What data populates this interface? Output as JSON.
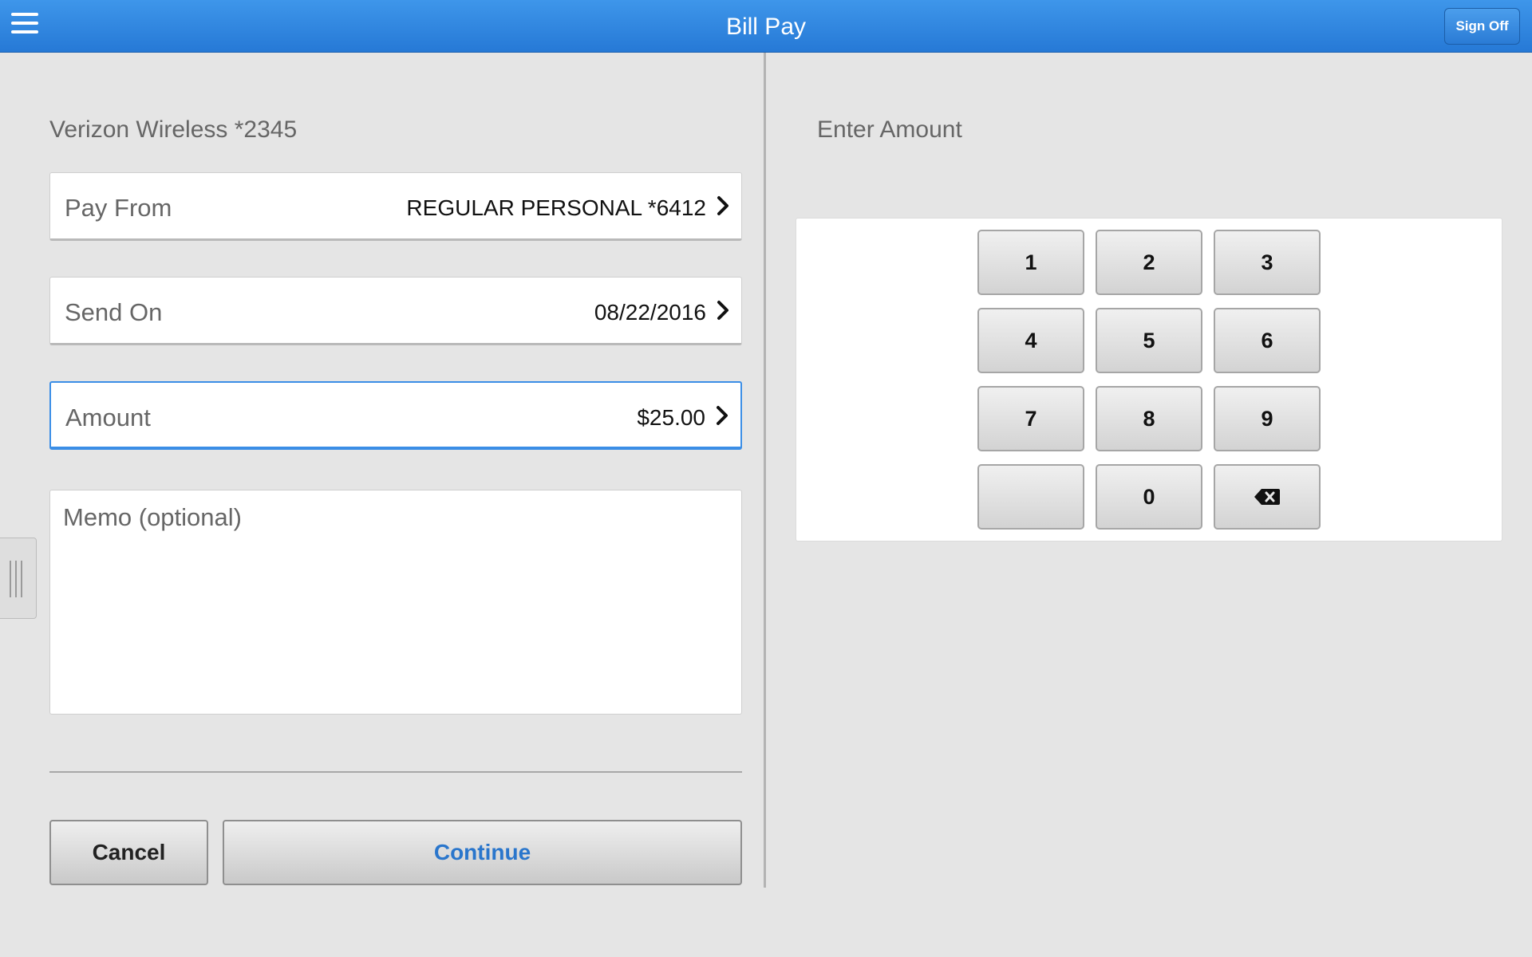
{
  "header": {
    "title": "Bill Pay",
    "sign_off_label": "Sign Off"
  },
  "form": {
    "payee": "Verizon Wireless *2345",
    "rows": [
      {
        "label": "Pay From",
        "value": "REGULAR PERSONAL *6412"
      },
      {
        "label": "Send On",
        "value": "08/22/2016"
      },
      {
        "label": "Amount",
        "value": "$25.00"
      }
    ],
    "memo_placeholder": "Memo (optional)",
    "cancel_label": "Cancel",
    "continue_label": "Continue"
  },
  "keypad": {
    "title": "Enter Amount",
    "keys": [
      "1",
      "2",
      "3",
      "4",
      "5",
      "6",
      "7",
      "8",
      "9",
      "",
      "0",
      "backspace-icon"
    ]
  },
  "colors": {
    "header": "#2b7fda",
    "accent": "#3b8ee6",
    "continue_text": "#2a76cc",
    "background": "#e5e5e5"
  }
}
